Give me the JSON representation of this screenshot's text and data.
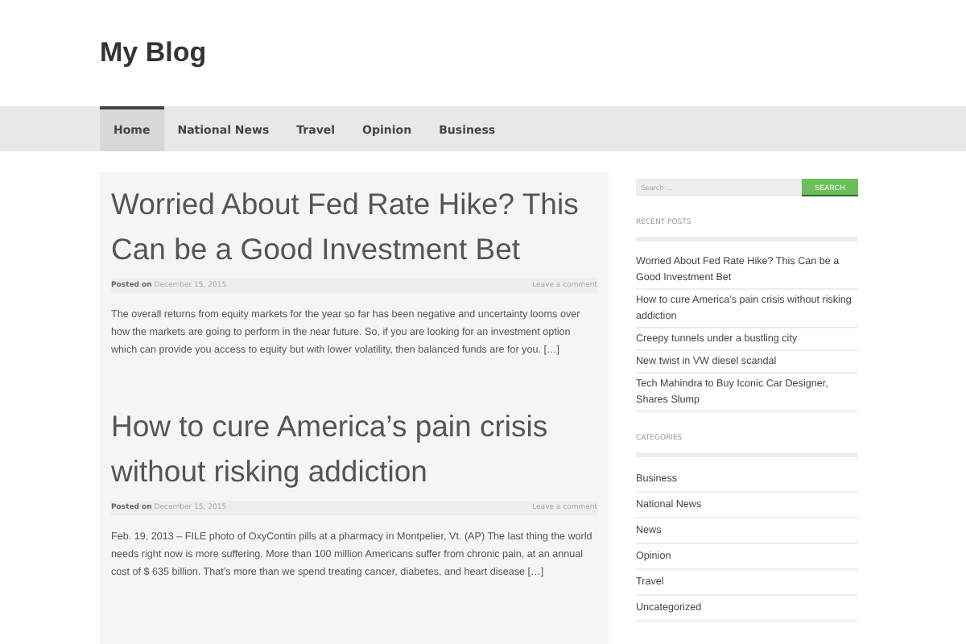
{
  "site": {
    "title": "My Blog"
  },
  "nav": [
    {
      "label": "Home",
      "selected": true
    },
    {
      "label": "National News",
      "selected": false
    },
    {
      "label": "Travel",
      "selected": false
    },
    {
      "label": "Opinion",
      "selected": false
    },
    {
      "label": "Business",
      "selected": false
    }
  ],
  "posts": [
    {
      "title": "Worried About Fed Rate Hike? This Can be a Good Investment Bet",
      "posted_label": "Posted on",
      "date": "December 15, 2015",
      "comment_link": "Leave a comment",
      "excerpt": "The overall returns from equity markets for the year so far has been negative and uncertainty looms over how the markets are going to perform in the near future. So, if you are looking for an investment option which can provide you access to equity but with lower volatility, then balanced funds are for you. […]"
    },
    {
      "title": "How to cure America’s pain crisis without risking addiction",
      "posted_label": "Posted on",
      "date": "December 15, 2015",
      "comment_link": "Leave a comment",
      "excerpt": "Feb. 19, 2013 – FILE photo of OxyContin pills at a pharmacy in Montpelier, Vt. (AP) The last thing the world needs right now is more suffering.  More than 100 million Americans suffer from chronic pain, at an annual cost of $ 635 billion. That’s more than we spend treating cancer, diabetes, and heart disease […]"
    }
  ],
  "search": {
    "placeholder": "Search …",
    "button": "SEARCH"
  },
  "recent_posts": {
    "heading": "RECENT POSTS",
    "items": [
      "Worried About Fed Rate Hike? This Can be a Good Investment Bet",
      "How to cure America’s pain crisis without risking addiction",
      "Creepy tunnels under a bustling city",
      "New twist in VW diesel scandal",
      "Tech Mahindra to Buy Iconic Car Designer, Shares Slump"
    ]
  },
  "categories": {
    "heading": "CATEGORIES",
    "items": [
      "Business",
      "National News",
      "News",
      "Opinion",
      "Travel",
      "Uncategorized"
    ]
  }
}
